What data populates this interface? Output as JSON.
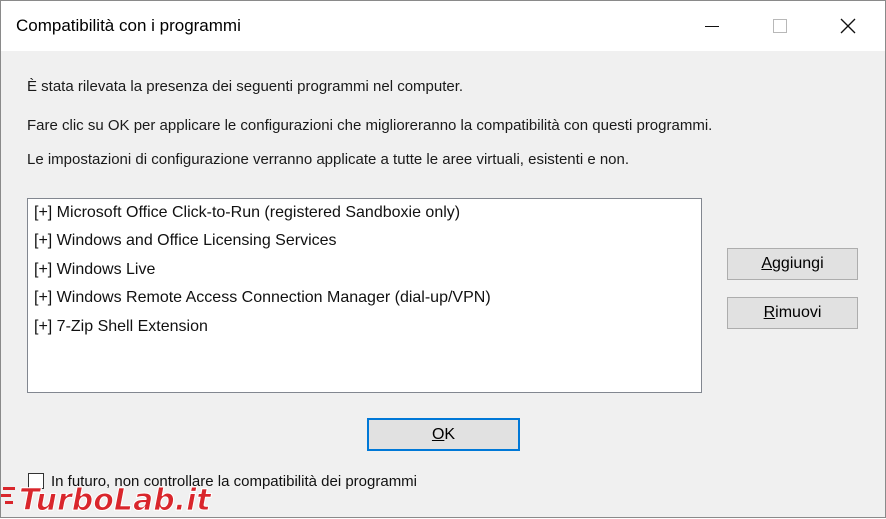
{
  "window": {
    "title": "Compatibilità con i programmi",
    "controls": [
      "minimize-icon",
      "maximize-icon",
      "close-icon"
    ]
  },
  "messages": [
    "È stata rilevata la presenza dei seguenti programmi nel computer.",
    "Fare clic su OK per applicare le configurazioni che miglioreranno la compatibilità con questi programmi.",
    "Le impostazioni di configurazione verranno applicate a tutte le aree virtuali, esistenti e non."
  ],
  "programs": [
    "[+]  Microsoft Office Click-to-Run (registered Sandboxie only)",
    "[+]  Windows and Office Licensing Services",
    "[+]  Windows Live",
    "[+]  Windows Remote Access Connection Manager (dial-up/VPN)",
    "[+]  7-Zip Shell Extension"
  ],
  "buttons": {
    "add_first": "A",
    "add_rest": "ggiungi",
    "remove_first": "R",
    "remove_rest": "imuovi",
    "ok_first": "O",
    "ok_rest": "K"
  },
  "checkbox": {
    "label": "In futuro, non controllare la compatibilità dei programmi",
    "checked": false
  },
  "watermark": {
    "text": "TurboLab.it",
    "color": "#d9262c"
  }
}
